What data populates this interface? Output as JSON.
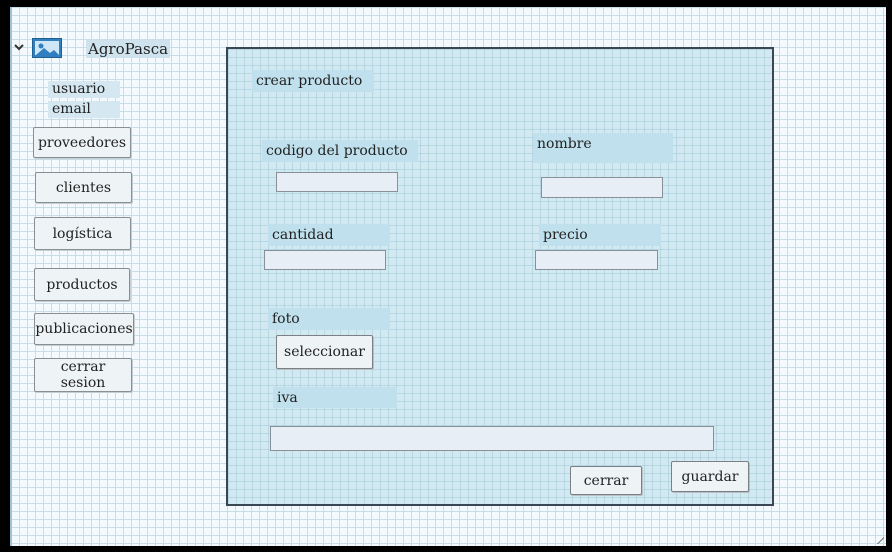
{
  "app": {
    "brand": "AgroPasca"
  },
  "sidebar": {
    "user_label": "usuario",
    "email_label": "email",
    "items": [
      {
        "label": "proveedores"
      },
      {
        "label": "clientes"
      },
      {
        "label": "logística"
      },
      {
        "label": "productos"
      },
      {
        "label": "publicaciones"
      },
      {
        "label": "cerrar sesion"
      }
    ]
  },
  "form": {
    "title": "crear producto",
    "code_label": "codigo del producto",
    "code_value": "",
    "name_label": "nombre",
    "name_value": "",
    "quantity_label": "cantidad",
    "quantity_value": "",
    "price_label": "precio",
    "price_value": "",
    "photo_label": "foto",
    "select_button": "seleccionar",
    "iva_label": "iva",
    "iva_value": "",
    "close_button": "cerrar",
    "save_button": "guardar"
  },
  "colors": {
    "panel_bg": "#d3e9f1",
    "canvas_bg": "#f3f9fc",
    "label_bg": "#bfe0ec"
  },
  "icons": {
    "expand": "chevron-down-icon",
    "brand": "image-icon"
  }
}
